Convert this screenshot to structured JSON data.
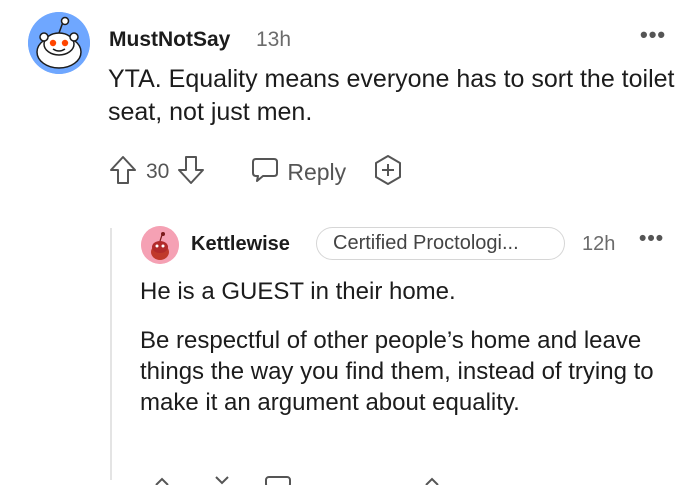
{
  "comment": {
    "username": "MustNotSay",
    "time": "13h",
    "body": "YTA. Equality means everyone has to sort the toilet seat, not just men.",
    "votes": "30",
    "reply_label": "Reply",
    "avatar_color": "#6fa7ff"
  },
  "reply": {
    "username": "Kettlewise",
    "flair": "Certified Proctologi...",
    "time": "12h",
    "paragraph1": "He is a GUEST in their home.",
    "paragraph2": "Be respectful of other people’s home and leave things the way you find them, instead of trying to make it an argument about equality.",
    "avatar_color": "#f5a1b4"
  },
  "icons": {
    "upvote": "arrow-up-icon",
    "downvote": "arrow-down-icon",
    "reply": "speech-bubble-icon",
    "award": "award-plus-icon",
    "more": "more-options-icon"
  }
}
